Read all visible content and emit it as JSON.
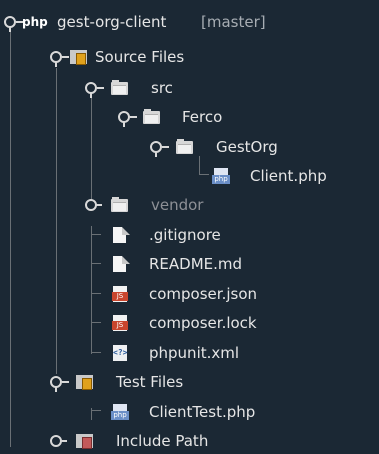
{
  "project": {
    "logo_text": "php",
    "name": "gest-org-client",
    "branch": "[master]"
  },
  "nodes": [
    {
      "label": "Source Files",
      "icon": "source-package-icon",
      "state": "expanded"
    },
    {
      "label": "src",
      "icon": "folder-icon",
      "state": "expanded"
    },
    {
      "label": "Ferco",
      "icon": "folder-icon",
      "state": "expanded"
    },
    {
      "label": "GestOrg",
      "icon": "folder-icon",
      "state": "expanded"
    },
    {
      "label": "Client.php",
      "icon": "php-file-icon",
      "state": "leaf"
    },
    {
      "label": "vendor",
      "icon": "folder-icon",
      "state": "collapsed"
    },
    {
      "label": ".gitignore",
      "icon": "text-file-icon",
      "state": "leaf"
    },
    {
      "label": "README.md",
      "icon": "text-file-icon",
      "state": "leaf"
    },
    {
      "label": "composer.json",
      "icon": "js-file-icon",
      "state": "leaf"
    },
    {
      "label": "composer.lock",
      "icon": "js-file-icon",
      "state": "leaf"
    },
    {
      "label": "phpunit.xml",
      "icon": "xml-file-icon",
      "state": "leaf"
    },
    {
      "label": "Test Files",
      "icon": "source-package-icon",
      "state": "expanded"
    },
    {
      "label": "ClientTest.php",
      "icon": "php-file-icon",
      "state": "leaf"
    },
    {
      "label": "Include Path",
      "icon": "library-icon",
      "state": "collapsed"
    }
  ],
  "icon_text": {
    "php_tag": "php",
    "js_tag": "JS",
    "xml_tag": "<?>"
  }
}
